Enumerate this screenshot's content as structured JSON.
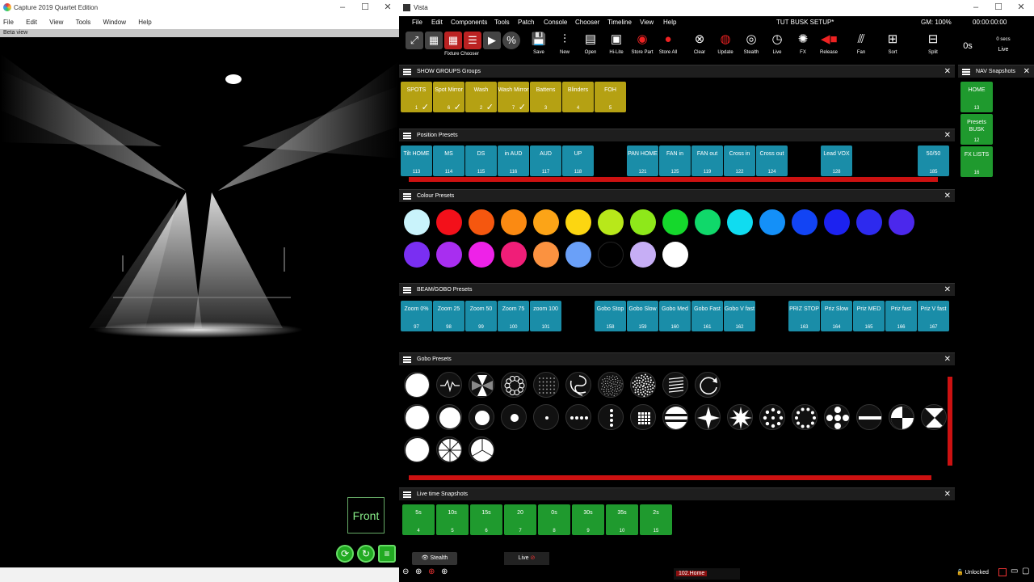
{
  "capture": {
    "title": "Capture 2019 Quartet Edition",
    "menu": [
      "File",
      "Edit",
      "View",
      "Tools",
      "Window",
      "Help"
    ],
    "tab": "Beta view",
    "front_label": "Front"
  },
  "vista": {
    "title": "Vista",
    "menu": [
      "File",
      "Edit",
      "Components",
      "Tools",
      "Patch",
      "Console",
      "Chooser",
      "Timeline",
      "View",
      "Help"
    ],
    "show": "TUT BUSK SETUP*",
    "gm": "GM: 100%",
    "time": "00:00:00:00",
    "toolbar": {
      "fixture_chooser": "Fixture Chooser",
      "buttons": [
        "Save",
        "New",
        "Open",
        "Hi-Lite",
        "Store Part",
        "Store All",
        "Clear",
        "Update",
        "Stealth",
        "Live",
        "FX",
        "Release",
        "Fan",
        "Sort",
        "Split"
      ],
      "timing": "0s",
      "secs": "0 secs",
      "live": "Live"
    },
    "groups": {
      "title": "SHOW GROUPS Groups",
      "items": [
        {
          "l1": "SPOTS",
          "num": "1"
        },
        {
          "l1": "Spot Mirror",
          "num": "6"
        },
        {
          "l1": "Wash",
          "num": "2"
        },
        {
          "l1": "Wash Mirror",
          "num": "7"
        },
        {
          "l1": "Battens",
          "num": "3"
        },
        {
          "l1": "Blinders",
          "num": "4"
        },
        {
          "l1": "FOH",
          "num": "5"
        }
      ]
    },
    "nav": {
      "title": "NAV Snapshots",
      "items": [
        {
          "l": "HOME",
          "n": "13"
        },
        {
          "l": "Presets BUSK",
          "n": "12"
        },
        {
          "l": "FX LISTS",
          "n": "16"
        }
      ]
    },
    "position": {
      "title": "Position Presets",
      "items": [
        {
          "l": "Tilt HOME",
          "n": "113"
        },
        {
          "l": "MS",
          "n": "114"
        },
        {
          "l": "DS",
          "n": "115"
        },
        {
          "l": "in AUD",
          "n": "116"
        },
        {
          "l": "AUD",
          "n": "117"
        },
        {
          "l": "UP",
          "n": "118"
        },
        {
          "l": "PAN HOME",
          "n": "121"
        },
        {
          "l": "FAN in",
          "n": "125"
        },
        {
          "l": "FAN out",
          "n": "119"
        },
        {
          "l": "Cross in",
          "n": "122"
        },
        {
          "l": "Cross out",
          "n": "124"
        },
        {
          "l": "Lead VOX",
          "n": "128"
        },
        {
          "l": "50/50",
          "n": "185"
        }
      ]
    },
    "colour": {
      "title": "Colour Presets",
      "colors": [
        "#c9f3fb",
        "#f3101a",
        "#f5570f",
        "#fb8a12",
        "#fca417",
        "#fcd611",
        "#b8e81a",
        "#8ee81a",
        "#15d82c",
        "#10d86a",
        "#10dcf0",
        "#1490f8",
        "#1244f4",
        "#1c22f0",
        "#2d2aee",
        "#4b28ec",
        "#7a2ff2",
        "#a82ef0",
        "#ee22e8",
        "#f01e78",
        "#fb9240",
        "#6aa0f8",
        "#000000",
        "#c6aef5",
        "#ffffff"
      ]
    },
    "beam": {
      "title": "BEAM/GOBO Presets",
      "items": [
        {
          "l": "Zoom 0%",
          "n": "97"
        },
        {
          "l": "Zoom 25",
          "n": "98"
        },
        {
          "l": "Zoom 50",
          "n": "99"
        },
        {
          "l": "Zoom 75",
          "n": "100"
        },
        {
          "l": "zoom 100",
          "n": "101"
        },
        {
          "l": "Gobo Stop",
          "n": "158"
        },
        {
          "l": "Gobo Slow",
          "n": "159"
        },
        {
          "l": "Gobo Med",
          "n": "160"
        },
        {
          "l": "Gobo Fast",
          "n": "161"
        },
        {
          "l": "Gobo V fast",
          "n": "162"
        },
        {
          "l": "PRIZ STOP",
          "n": "163"
        },
        {
          "l": "Priz Slow",
          "n": "164"
        },
        {
          "l": "Priz MED",
          "n": "165"
        },
        {
          "l": "Priz fast",
          "n": "166"
        },
        {
          "l": "Priz V fast",
          "n": "167"
        }
      ]
    },
    "gobo": {
      "title": "Gobo Presets",
      "rows": [
        [
          "open",
          "wave",
          "fan-4",
          "petal-ring",
          "grid-dots",
          "swirl",
          "dots-fine",
          "dots-medium",
          "lines",
          "ring-arrow"
        ],
        [
          "open",
          "circle-lg",
          "circle-md",
          "circle-sm",
          "dot",
          "dots-row",
          "dots-col",
          "grid",
          "bars",
          "star-4",
          "star-8",
          "ring-dots",
          "ring-dots-lg",
          "cross-dots",
          "bar",
          "half",
          "bowtie"
        ],
        [
          "open",
          "wheel",
          "tri"
        ]
      ]
    },
    "live": {
      "title": "Live time Snapshots",
      "items": [
        {
          "l": "5s",
          "n": "4"
        },
        {
          "l": "10s",
          "n": "5"
        },
        {
          "l": "15s",
          "n": "6"
        },
        {
          "l": "20",
          "n": "7"
        },
        {
          "l": "0s",
          "n": "8"
        },
        {
          "l": "30s",
          "n": "9"
        },
        {
          "l": "35s",
          "n": "10"
        },
        {
          "l": "2s",
          "n": "15"
        }
      ]
    },
    "bottom": {
      "stealth": "Stealth",
      "live": "Live",
      "cue": "102.Home",
      "unlocked": "Unlocked"
    }
  }
}
